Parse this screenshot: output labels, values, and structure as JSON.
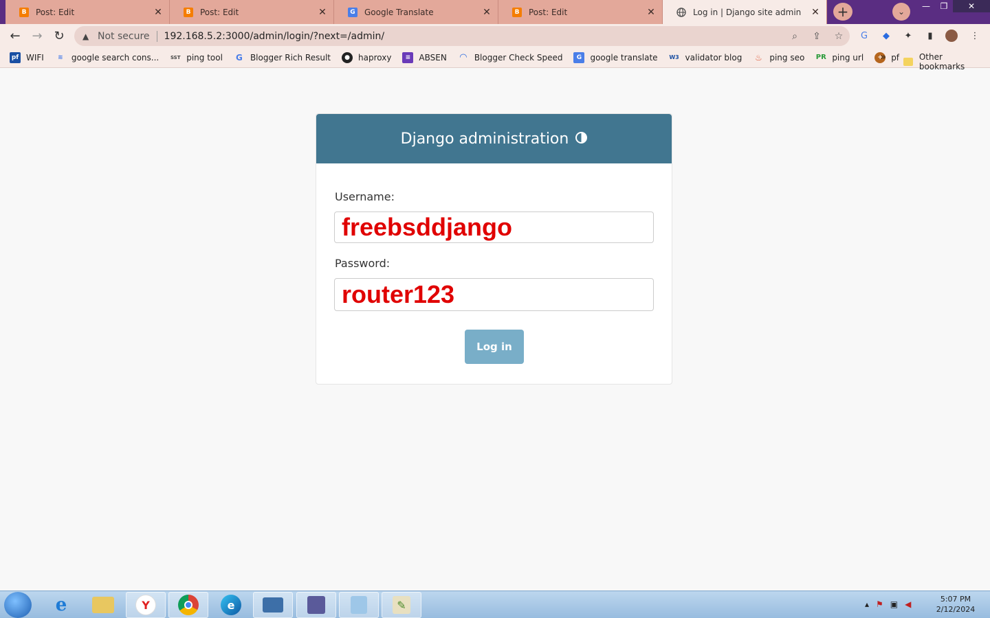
{
  "tabs": [
    {
      "title": "Post: Edit",
      "icon": "blogger-icon"
    },
    {
      "title": "Post: Edit",
      "icon": "blogger-icon"
    },
    {
      "title": "Google Translate",
      "icon": "translate-icon"
    },
    {
      "title": "Post: Edit",
      "icon": "blogger-icon"
    },
    {
      "title": "Log in | Django site admin",
      "icon": "globe-icon",
      "active": true
    }
  ],
  "toolbar": {
    "security_label": "Not secure",
    "url": "192.168.5.2:3000/admin/login/?next=/admin/"
  },
  "bookmarks": [
    {
      "label": "WIFI",
      "icon": "pfsense-icon"
    },
    {
      "label": "google search cons...",
      "icon": "search-console-icon"
    },
    {
      "label": "ping tool",
      "icon": "sst-icon"
    },
    {
      "label": "Blogger Rich Result",
      "icon": "google-icon"
    },
    {
      "label": "haproxy",
      "icon": "github-icon"
    },
    {
      "label": "ABSEN",
      "icon": "form-icon"
    },
    {
      "label": "Blogger Check Speed",
      "icon": "speed-icon"
    },
    {
      "label": "google translate",
      "icon": "translate-icon"
    },
    {
      "label": "validator blog",
      "icon": "w3c-icon"
    },
    {
      "label": "ping seo",
      "icon": "rocket-icon"
    },
    {
      "label": "ping url",
      "icon": "pr-icon"
    },
    {
      "label": "pf",
      "icon": "basketball-icon"
    }
  ],
  "bookmarks_other": "Other bookmarks",
  "login": {
    "header": "Django administration",
    "username_label": "Username:",
    "username_value": "freebsddjango",
    "password_label": "Password:",
    "password_value": "router123",
    "submit_label": "Log in"
  },
  "taskbar": {
    "time": "5:07 PM",
    "date": "2/12/2024"
  },
  "colors": {
    "header": "#417690",
    "button": "#79aec8",
    "input_text": "#e00000"
  }
}
